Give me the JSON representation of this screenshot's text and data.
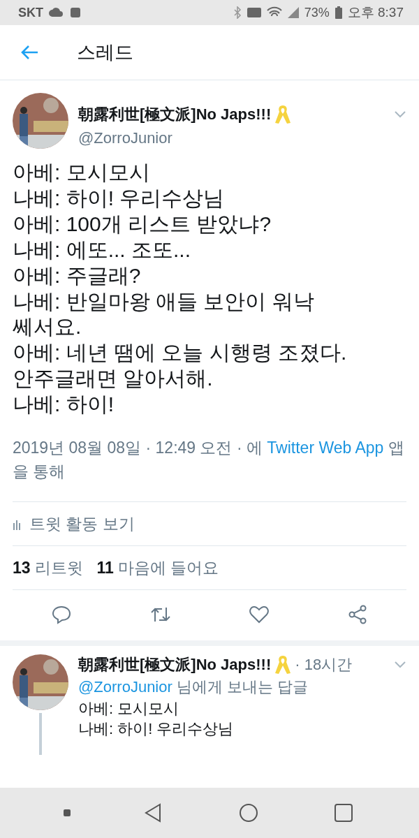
{
  "status_bar": {
    "carrier": "SKT",
    "battery": "73%",
    "time": "오후 8:37"
  },
  "header": {
    "title": "스레드"
  },
  "tweet": {
    "display_name": "朝露利世[極文派]No Japs!!!",
    "handle": "@ZorroJunior",
    "lines": [
      "아베: 모시모시",
      "나베: 하이! 우리수상님",
      "아베: 100개 리스트 받았냐?",
      "나베: 에또... 조또...",
      "아베: 주글래?",
      "나베: 반일마왕 애들 보안이 워낙",
      "쎄서요.",
      "아베: 네년 땜에 오늘 시행령 조졌다.",
      "안주글래면 알아서해.",
      "나베: 하이!"
    ],
    "meta_prefix": "2019년 08월 08일 · 12:49 오전 · 에",
    "meta_link": "Twitter Web App",
    "meta_suffix": "앱을 통해",
    "activity": "트윗 활동 보기",
    "stats": [
      {
        "count": "13",
        "label": "리트윗"
      },
      {
        "count": "11",
        "label": "마음에 들어요"
      }
    ]
  },
  "reply": {
    "display_name": "朝露利世[極文派]No Japs!!!",
    "age": "· 18시간",
    "reply_to": "@ZorroJunior",
    "reply_to_suffix": "님에게 보내는 답글",
    "lines": [
      "아베: 모시모시",
      "나베: 하이! 우리수상님"
    ]
  }
}
